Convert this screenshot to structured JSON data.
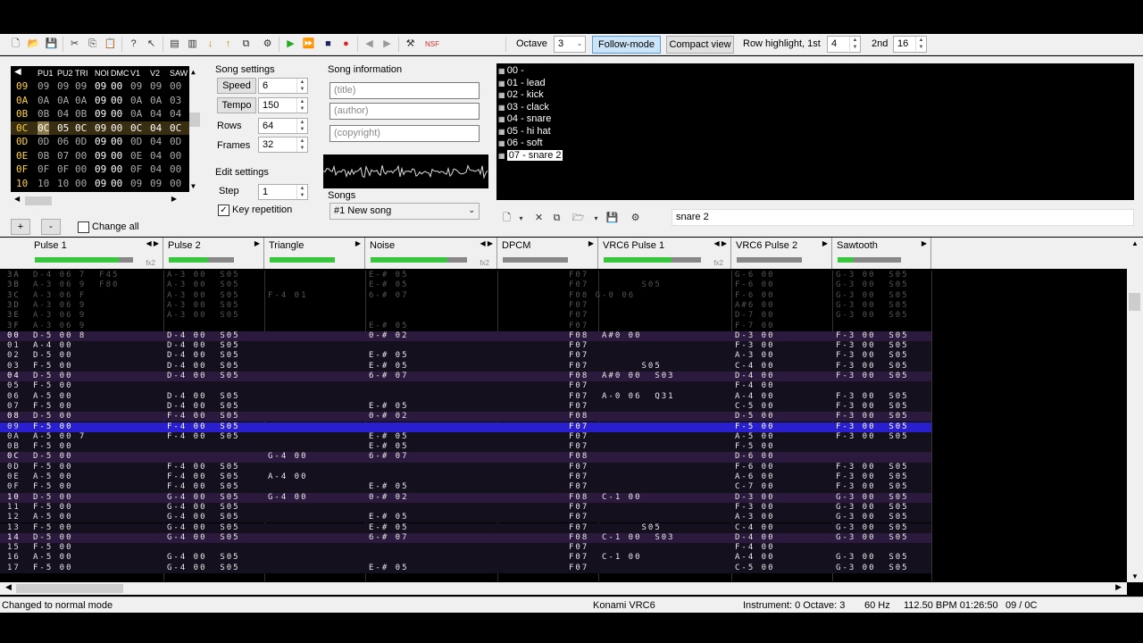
{
  "toolbar": {
    "octave_label": "Octave",
    "octave_value": "3",
    "follow_mode": "Follow-mode",
    "compact_view": "Compact view",
    "row_highlight_label": "Row highlight, 1st",
    "row_highlight_1st": "4",
    "second_label": "2nd",
    "row_highlight_2nd": "16",
    "nsf": "NSF"
  },
  "frame_editor": {
    "columns": [
      "PU1",
      "PU2",
      "TRI",
      "NOI",
      "DMC",
      "V1",
      "V2",
      "SAW"
    ],
    "rows": [
      {
        "n": "09",
        "v": [
          "09",
          "09",
          "09",
          "09",
          "00",
          "09",
          "09",
          "00"
        ]
      },
      {
        "n": "0A",
        "v": [
          "0A",
          "0A",
          "0A",
          "09",
          "00",
          "0A",
          "0A",
          "03"
        ]
      },
      {
        "n": "0B",
        "v": [
          "0B",
          "04",
          "0B",
          "09",
          "00",
          "0A",
          "04",
          "04"
        ]
      },
      {
        "n": "0C",
        "v": [
          "0C",
          "05",
          "0C",
          "09",
          "00",
          "0C",
          "04",
          "0C"
        ]
      },
      {
        "n": "0D",
        "v": [
          "0D",
          "06",
          "0D",
          "09",
          "00",
          "0D",
          "04",
          "0D"
        ]
      },
      {
        "n": "0E",
        "v": [
          "0B",
          "07",
          "00",
          "09",
          "00",
          "0E",
          "04",
          "00"
        ]
      },
      {
        "n": "0F",
        "v": [
          "0F",
          "0F",
          "00",
          "09",
          "00",
          "0F",
          "04",
          "00"
        ]
      },
      {
        "n": "10",
        "v": [
          "10",
          "10",
          "00",
          "09",
          "00",
          "09",
          "09",
          "00"
        ]
      }
    ],
    "add": "+",
    "remove": "-",
    "change_all": "Change all"
  },
  "song_settings": {
    "title": "Song settings",
    "speed_label": "Speed",
    "speed": "6",
    "tempo_label": "Tempo",
    "tempo": "150",
    "rows_label": "Rows",
    "rows": "64",
    "frames_label": "Frames",
    "frames": "32"
  },
  "edit_settings": {
    "title": "Edit settings",
    "step_label": "Step",
    "step": "1",
    "key_repetition": "Key repetition"
  },
  "song_info": {
    "title": "Song information",
    "title_ph": "(title)",
    "author_ph": "(author)",
    "copyright_ph": "(copyright)",
    "songs_label": "Songs",
    "song_selected": "#1 New song"
  },
  "instruments": [
    "00 -",
    "01 - lead",
    "02 - kick",
    "03 - clack",
    "04 - snare",
    "05 - hi hat",
    "06 - soft",
    "07 - snare 2"
  ],
  "instrument_name": "snare 2",
  "channels": [
    {
      "name": "Pulse 1",
      "fx": "fx2",
      "level": 0.85
    },
    {
      "name": "Pulse 2",
      "level": 0.6
    },
    {
      "name": "Triangle",
      "level": 1.0
    },
    {
      "name": "Noise",
      "fx": "fx2",
      "level": 0.8
    },
    {
      "name": "DPCM",
      "level": 0.0
    },
    {
      "name": "VRC6 Pulse 1",
      "fx": "fx2",
      "level": 0.7
    },
    {
      "name": "VRC6 Pulse 2",
      "level": 0.0
    },
    {
      "name": "Sawtooth",
      "level": 0.25
    }
  ],
  "pattern_rows": [
    {
      "n": "3A",
      "c": [
        "D-4 06 7  F45",
        "A-3 00  S05",
        "",
        "E-# 05",
        "F07",
        "",
        "G-6 00",
        "G-3 00  S05"
      ],
      "prev": true
    },
    {
      "n": "3B",
      "c": [
        "A-3 06 9  F80",
        "A-3 00  S05",
        "",
        "E-# 05",
        "F07",
        "      S05",
        "F-6 00",
        "G-3 00  S05"
      ],
      "prev": true
    },
    {
      "n": "3C",
      "c": [
        "A-3 06 F",
        "A-3 00  S05",
        "F-4 01",
        "6-# 07",
        "F08 G-0 06",
        "",
        "F-6 00",
        "G-3 00  S05"
      ],
      "prev": true
    },
    {
      "n": "3D",
      "c": [
        "A-3 06 9",
        "A-3 00  S05",
        "",
        "",
        "F07",
        "",
        "A#6 00",
        "G-3 00  S05"
      ],
      "prev": true
    },
    {
      "n": "3E",
      "c": [
        "A-3 06 9",
        "A-3 00  S05",
        "",
        "",
        "F07",
        "",
        "D-7 00",
        "G-3 00  S05"
      ],
      "prev": true
    },
    {
      "n": "3F",
      "c": [
        "A-3 06 9",
        "",
        "",
        "E-# 05",
        "F07",
        "",
        "F-7 00",
        ""
      ],
      "prev": true
    },
    {
      "n": "00",
      "c": [
        "D-5 00 8",
        "D-4 00  S05",
        "",
        "0-# 02",
        "F08",
        "A#0 00",
        "D-3 00",
        "F-3 00  S05"
      ]
    },
    {
      "n": "01",
      "c": [
        "A-4 00",
        "D-4 00  S05",
        "",
        "",
        "F07",
        "",
        "F-3 00",
        "F-3 00  S05"
      ]
    },
    {
      "n": "02",
      "c": [
        "D-5 00",
        "D-4 00  S05",
        "",
        "E-# 05",
        "F07",
        "",
        "A-3 00",
        "F-3 00  S05"
      ]
    },
    {
      "n": "03",
      "c": [
        "F-5 00",
        "D-4 00  S05",
        "",
        "E-# 05",
        "F07",
        "      S05",
        "C-4 00",
        "F-3 00  S05"
      ]
    },
    {
      "n": "04",
      "c": [
        "D-5 00",
        "D-4 00  S05",
        "",
        "6-# 07",
        "F08",
        "A#0 00  S03",
        "D-4 00",
        "F-3 00  S05"
      ]
    },
    {
      "n": "05",
      "c": [
        "F-5 00",
        "",
        "",
        "",
        "F07",
        "",
        "F-4 00",
        ""
      ]
    },
    {
      "n": "06",
      "c": [
        "A-5 00",
        "D-4 00  S05",
        "",
        "",
        "F07",
        "A-0 06  Q31",
        "A-4 00",
        "F-3 00  S05"
      ]
    },
    {
      "n": "07",
      "c": [
        "F-5 00",
        "D-4 00  S05",
        "",
        "E-# 05",
        "F07",
        "",
        "C-5 00",
        "F-3 00  S05"
      ]
    },
    {
      "n": "08",
      "c": [
        "D-5 00",
        "F-4 00  S05",
        "",
        "0-# 02",
        "F08",
        "",
        "D-5 00",
        "F-3 00  S05"
      ]
    },
    {
      "n": "09",
      "c": [
        "F-5 00",
        "F-4 00  S05",
        "",
        "",
        "F07",
        "",
        "F-5 00",
        "F-3 00  S05"
      ],
      "cur": true
    },
    {
      "n": "0A",
      "c": [
        "A-5 00 7",
        "F-4 00  S05",
        "",
        "E-# 05",
        "F07",
        "",
        "A-5 00",
        "F-3 00  S05"
      ]
    },
    {
      "n": "0B",
      "c": [
        "F-5 00",
        "",
        "",
        "E-# 05",
        "F07",
        "",
        "F-5 00",
        ""
      ]
    },
    {
      "n": "0C",
      "c": [
        "D-5 00",
        "",
        "G-4 00",
        "6-# 07",
        "F08",
        "",
        "D-6 00",
        ""
      ]
    },
    {
      "n": "0D",
      "c": [
        "F-5 00",
        "F-4 00  S05",
        "",
        "",
        "F07",
        "",
        "F-6 00",
        "F-3 00  S05"
      ]
    },
    {
      "n": "0E",
      "c": [
        "A-5 00",
        "F-4 00  S05",
        "A-4 00",
        "",
        "F07",
        "",
        "A-6 00",
        "F-3 00  S05"
      ]
    },
    {
      "n": "0F",
      "c": [
        "F-5 00",
        "F-4 00  S05",
        "",
        "E-# 05",
        "F07",
        "",
        "C-7 00",
        "F-3 00  S05"
      ]
    },
    {
      "n": "10",
      "c": [
        "D-5 00",
        "G-4 00  S05",
        "G-4 00",
        "0-# 02",
        "F08",
        "C-1 00",
        "D-3 00",
        "G-3 00  S05"
      ]
    },
    {
      "n": "11",
      "c": [
        "F-5 00",
        "G-4 00  S05",
        "",
        "",
        "F07",
        "",
        "F-3 00",
        "G-3 00  S05"
      ]
    },
    {
      "n": "12",
      "c": [
        "A-5 00",
        "G-4 00  S05",
        "",
        "E-# 05",
        "F07",
        "",
        "A-3 00",
        "G-3 00  S05"
      ]
    },
    {
      "n": "13",
      "c": [
        "F-5 00",
        "G-4 00  S05",
        "",
        "E-# 05",
        "F07",
        "      S05",
        "C-4 00",
        "G-3 00  S05"
      ]
    },
    {
      "n": "14",
      "c": [
        "D-5 00",
        "G-4 00  S05",
        "",
        "6-# 07",
        "F08",
        "C-1 00  S03",
        "D-4 00",
        "G-3 00  S05"
      ]
    },
    {
      "n": "15",
      "c": [
        "F-5 00",
        "",
        "",
        "",
        "F07",
        "",
        "F-4 00",
        ""
      ]
    },
    {
      "n": "16",
      "c": [
        "A-5 00",
        "G-4 00  S05",
        "",
        "",
        "F07",
        "C-1 00",
        "A-4 00",
        "G-3 00  S05"
      ]
    },
    {
      "n": "17",
      "c": [
        "F-5 00",
        "G-4 00  S05",
        "",
        "E-# 05",
        "F07",
        "",
        "C-5 00",
        "G-3 00  S05"
      ]
    }
  ],
  "status": {
    "message": "Changed to normal mode",
    "chip": "Konami VRC6",
    "instrument": "Instrument: 0 Octave: 3",
    "rate": "60 Hz",
    "bpm": "112.50 BPM  01:26:50",
    "position": "09 / 0C"
  },
  "colors": {
    "accent": "#3c3cff",
    "current_row": "#2a1fcf",
    "note": "#ffffff",
    "dim": "#7a7a7a"
  }
}
